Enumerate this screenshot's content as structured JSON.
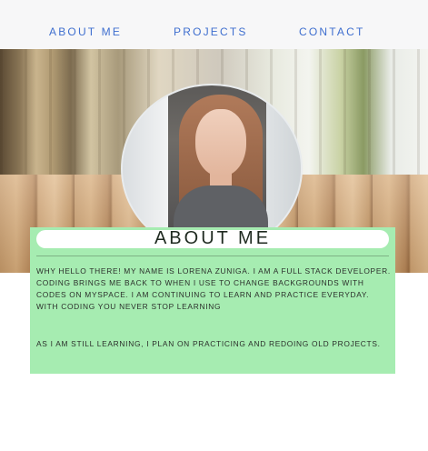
{
  "nav": {
    "items": [
      "ABOUT ME",
      "PROJECTS",
      "CONTACT"
    ]
  },
  "hero": {
    "image": "profile-photo"
  },
  "about": {
    "title": "ABOUT ME",
    "paragraphs": [
      "WHY HELLO THERE! MY NAME IS LORENA ZUNIGA. I AM A FULL STACK DEVELOPER. CODING BRINGS ME BACK TO WHEN I USE TO CHANGE BACKGROUNDS WITH CODES ON MYSPACE. I AM CONTINUING TO LEARN AND PRACTICE EVERYDAY. WITH CODING YOU NEVER STOP LEARNING",
      "AS I AM STILL LEARNING, I PLAN ON PRACTICING AND REDOING OLD PROJECTS."
    ]
  },
  "colors": {
    "nav_link": "#3f6fcf",
    "card_bg": "#a6ecb1",
    "nav_bg": "#f7f7f8"
  }
}
